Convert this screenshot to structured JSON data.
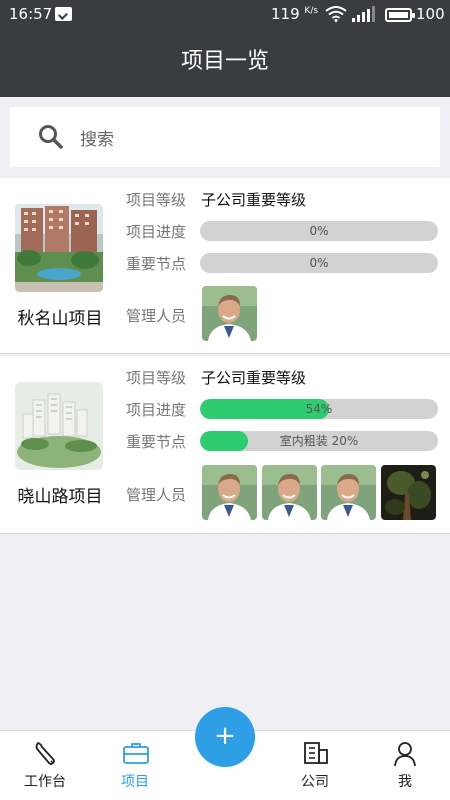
{
  "statusbar": {
    "time": "16:57",
    "speed": "119",
    "speed_unit": "K/s",
    "battery": "100"
  },
  "header": {
    "title": "项目一览"
  },
  "search": {
    "placeholder": "搜索"
  },
  "labels": {
    "level": "项目等级",
    "progress": "项目进度",
    "node": "重要节点",
    "manager": "管理人员"
  },
  "projects": [
    {
      "name": "秋名山项目",
      "level": "子公司重要等级",
      "progress": {
        "value": 0,
        "text": "0%"
      },
      "node": {
        "value": 0,
        "text": "0%"
      },
      "managers": [
        "avatar-man"
      ]
    },
    {
      "name": "晓山路项目",
      "level": "子公司重要等级",
      "progress": {
        "value": 54,
        "text": "54%"
      },
      "node": {
        "value": 20,
        "text": "室内粗装 20%"
      },
      "managers": [
        "avatar-man",
        "avatar-man",
        "avatar-man",
        "avatar-dark"
      ]
    }
  ],
  "tabs": [
    {
      "label": "工作台",
      "icon": "wrench-icon"
    },
    {
      "label": "项目",
      "icon": "briefcase-icon",
      "active": true
    },
    {
      "label": "+",
      "icon": "plus-icon"
    },
    {
      "label": "公司",
      "icon": "building-icon"
    },
    {
      "label": "我",
      "icon": "person-icon"
    }
  ],
  "colors": {
    "header_bg": "#3a3c3f",
    "accent": "#2f9fe5",
    "progress_fill": "#2ecc71",
    "bar_bg": "#d2d2d2"
  }
}
